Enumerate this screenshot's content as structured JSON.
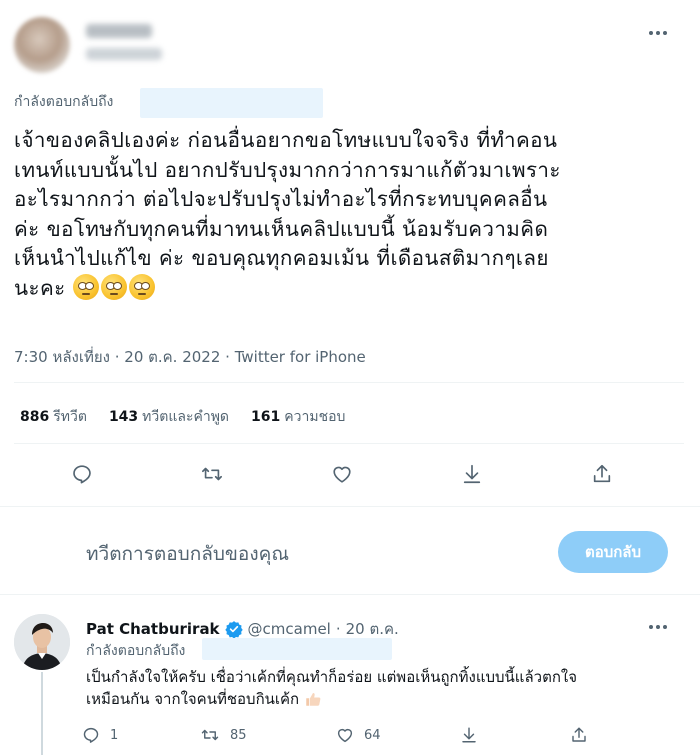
{
  "main_tweet": {
    "more_label": "More",
    "reply_prefix": "กำลังตอบกลับถึง",
    "text_lines": [
      "เจ้าของคลิปเองค่ะ ก่อนอื่นอยากขอโทษแบบใจจริง ที่ทำคอน",
      "เทนท์แบบนั้นไป อยากปรับปรุงมากกว่าการมาแก้ตัวมาเพราะ",
      "อะไรมากกว่า ต่อไปจะปรับปรุงไม่ทำอะไรที่กระทบบุคคลอื่น",
      "ค่ะ ขอโทษกับทุกคนที่มาทนเห็นคลิปแบบนี้ น้อมรับความคิด",
      "เห็นนำไปแก้ไข ค่ะ ขอบคุณทุกคอมเม้น ที่เดือนสติมากๆเลย",
      "นะคะ"
    ],
    "emoji_count": 3,
    "timestamp": "7:30 หลังเที่ยง · 20 ต.ค. 2022 · Twitter for iPhone",
    "stats": [
      {
        "count": "886",
        "label": "รีทวีต"
      },
      {
        "count": "143",
        "label": "ทวีตและคำพูด"
      },
      {
        "count": "161",
        "label": "ความชอบ"
      }
    ],
    "icons": [
      "reply-icon",
      "retweet-icon",
      "like-icon",
      "share-down-icon",
      "share-up-icon"
    ]
  },
  "compose": {
    "placeholder": "ทวีตการตอบกลับของคุณ",
    "button_label": "ตอบกลับ",
    "button_color": "#8ecdf8"
  },
  "reply_tweet": {
    "name": "Pat Chatburirak",
    "handle": "@cmcamel",
    "separator": "·",
    "date": "20 ต.ค.",
    "reply_prefix": "กำลังตอบกลับถึง",
    "text_lines": [
      "เป็นกำลังใจให้ครับ เชื่อว่าเค้กที่คุณทำก็อร่อย แต่พอเห็นถูกทิ้งแบบนี้แล้วตกใจ",
      "เหมือนกัน จากใจคนที่ชอบกินเค้ก"
    ],
    "reply_count": "1",
    "retweet_count": "85",
    "like_count": "64",
    "verified_color": "#1d9bf0"
  }
}
